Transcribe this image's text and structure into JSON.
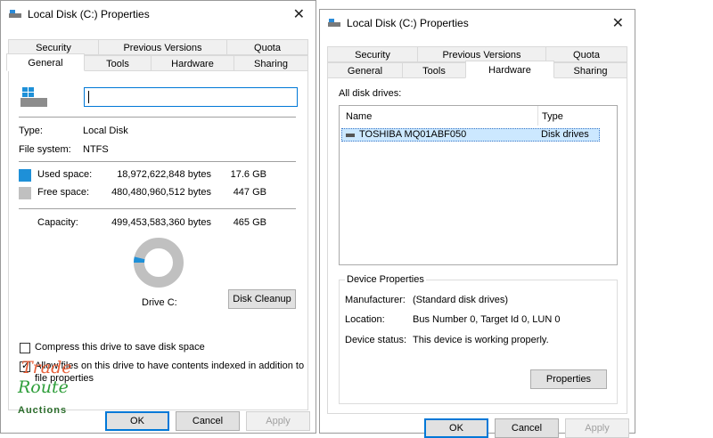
{
  "left": {
    "title": "Local Disk (C:) Properties",
    "tabs_back": [
      "Security",
      "Previous Versions",
      "Quota"
    ],
    "tabs_front": [
      "General",
      "Tools",
      "Hardware",
      "Sharing"
    ],
    "name_value": "",
    "type_label": "Type:",
    "type_value": "Local Disk",
    "fs_label": "File system:",
    "fs_value": "NTFS",
    "used_label": "Used space:",
    "used_bytes": "18,972,622,848 bytes",
    "used_gb": "17.6 GB",
    "free_label": "Free space:",
    "free_bytes": "480,480,960,512 bytes",
    "free_gb": "447 GB",
    "cap_label": "Capacity:",
    "cap_bytes": "499,453,583,360 bytes",
    "cap_gb": "465 GB",
    "used_fraction": 0.038,
    "drive_label": "Drive C:",
    "cleanup_button": "Disk Cleanup",
    "compress_label": "Compress this drive to save disk space",
    "index_label_line1": "Allow files on this drive to have contents indexed in addition to",
    "index_label_line2": "file properties",
    "ok": "OK",
    "cancel": "Cancel",
    "apply": "Apply",
    "colors": {
      "used": "#1e90d8",
      "free": "#c0c0c0"
    }
  },
  "right": {
    "title": "Local Disk (C:) Properties",
    "tabs_back": [
      "Security",
      "Previous Versions",
      "Quota"
    ],
    "tabs_front": [
      "General",
      "Tools",
      "Hardware",
      "Sharing"
    ],
    "all_drives_label": "All disk drives:",
    "col_name": "Name",
    "col_type": "Type",
    "drive_name": "TOSHIBA MQ01ABF050",
    "drive_type": "Disk drives",
    "device_props_label": "Device Properties",
    "manufacturer_label": "Manufacturer:",
    "manufacturer_value": "(Standard disk drives)",
    "location_label": "Location:",
    "location_value": "Bus Number 0, Target Id 0, LUN 0",
    "status_label": "Device status:",
    "status_value": "This device is working properly.",
    "properties_button": "Properties",
    "ok": "OK",
    "cancel": "Cancel",
    "apply": "Apply"
  },
  "watermark": {
    "line1": "Trade",
    "line2": "Route",
    "line3": "Auctions"
  }
}
